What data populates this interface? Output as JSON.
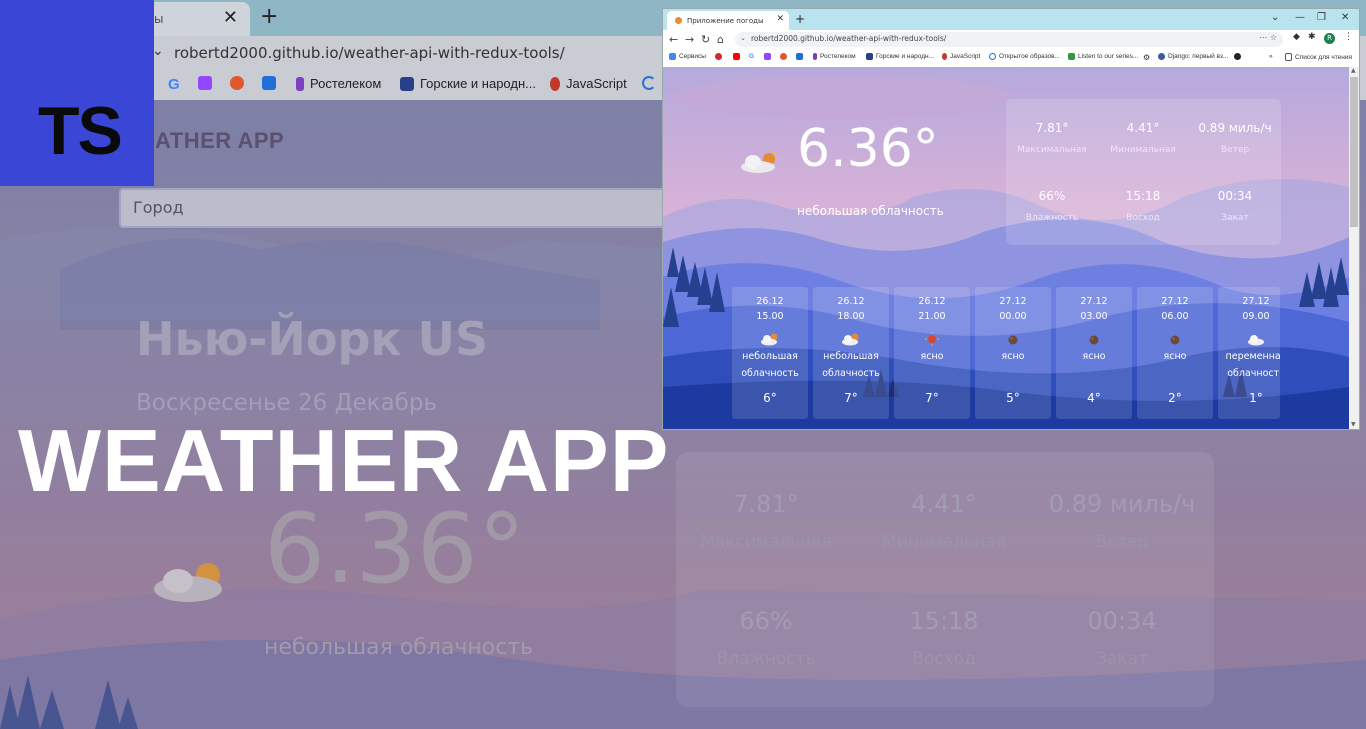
{
  "background": {
    "tab_title": "ы",
    "url": "robertd2000.github.io/weather-api-with-redux-tools/",
    "bookmarks": [
      "Ростелеком",
      "Горские и народн...",
      "JavaScript"
    ],
    "logo": "ATHER APP",
    "search_placeholder": "Город",
    "city": "Нью-Йорк US",
    "date": "Воскресенье 26 Декабрь",
    "temperature": "6.36°",
    "description": "небольшая облачность",
    "stats": [
      {
        "value": "7.81°",
        "label": "Максимальная"
      },
      {
        "value": "4.41°",
        "label": "Минимальная"
      },
      {
        "value": "0.89 миль/ч",
        "label": "Ветер"
      },
      {
        "value": "66%",
        "label": "Влажность"
      },
      {
        "value": "15:18",
        "label": "Восход"
      },
      {
        "value": "00:34",
        "label": "Закат"
      }
    ]
  },
  "badge": {
    "text": "TS",
    "color": "#3a46d6"
  },
  "headline": "WEATHER APP",
  "inset": {
    "tab_title": "Приложение погоды",
    "url": "robertd2000.github.io/weather-api-with-redux-tools/",
    "profile_initial": "R",
    "bookmarks": [
      "Сервисы",
      "Ростелеком",
      "Горские и народн...",
      "JavaScript",
      "Открытое образов...",
      "Listen to our series...",
      "Django: первый вз..."
    ],
    "reading_list": "Список для чтения",
    "temperature": "6.36°",
    "description": "небольшая облачность",
    "stats": [
      {
        "value": "7.81°",
        "label": "Максимальная"
      },
      {
        "value": "4.41°",
        "label": "Минимальная"
      },
      {
        "value": "0.89 миль/ч",
        "label": "Ветер"
      },
      {
        "value": "66%",
        "label": "Влажность"
      },
      {
        "value": "15:18",
        "label": "Восход"
      },
      {
        "value": "00:34",
        "label": "Закат"
      }
    ],
    "forecast": [
      {
        "date": "26.12",
        "time": "15.00",
        "icon": "cloud-sun-icon",
        "desc1": "небольшая",
        "desc2": "облачность",
        "temp": "6°"
      },
      {
        "date": "26.12",
        "time": "18.00",
        "icon": "cloud-sun-icon",
        "desc1": "небольшая",
        "desc2": "облачность",
        "temp": "7°"
      },
      {
        "date": "26.12",
        "time": "21.00",
        "icon": "sun-icon",
        "desc1": "ясно",
        "desc2": "",
        "temp": "7°"
      },
      {
        "date": "27.12",
        "time": "00.00",
        "icon": "moon-icon",
        "desc1": "ясно",
        "desc2": "",
        "temp": "5°"
      },
      {
        "date": "27.12",
        "time": "03.00",
        "icon": "moon-icon",
        "desc1": "ясно",
        "desc2": "",
        "temp": "4°"
      },
      {
        "date": "27.12",
        "time": "06.00",
        "icon": "moon-icon",
        "desc1": "ясно",
        "desc2": "",
        "temp": "2°"
      },
      {
        "date": "27.12",
        "time": "09.00",
        "icon": "cloud-icon",
        "desc1": "переменная",
        "desc2": "облачность",
        "temp": "1°"
      }
    ]
  }
}
